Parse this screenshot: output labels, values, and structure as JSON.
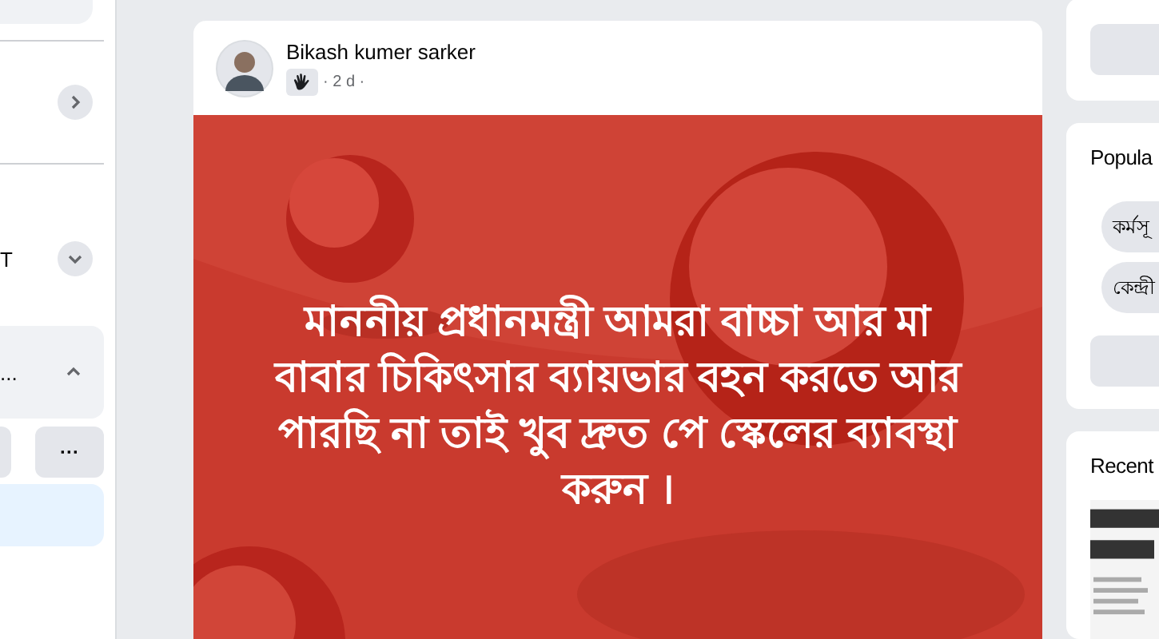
{
  "left_sidebar": {
    "section_label": "T",
    "group_label": "...",
    "group_expanded": true,
    "more_button": "···"
  },
  "post": {
    "author": "Bikash kumer sarker",
    "time": "· 2 d ·",
    "text": "মাননীয় প্রধানমন্ত্রী আমরা বাচ্চা আর মা বাবার চিকিৎসার ব্যায়ভার বহন করতে আর পারছি না তাই খুব দ্রুত পে স্কেলের ব্যাবস্থা করুন ।"
  },
  "right_sidebar": {
    "popular_title": "Popula",
    "chips": [
      "কর্মসূ",
      "কেন্দ্রী"
    ],
    "recent_title": "Recent"
  }
}
